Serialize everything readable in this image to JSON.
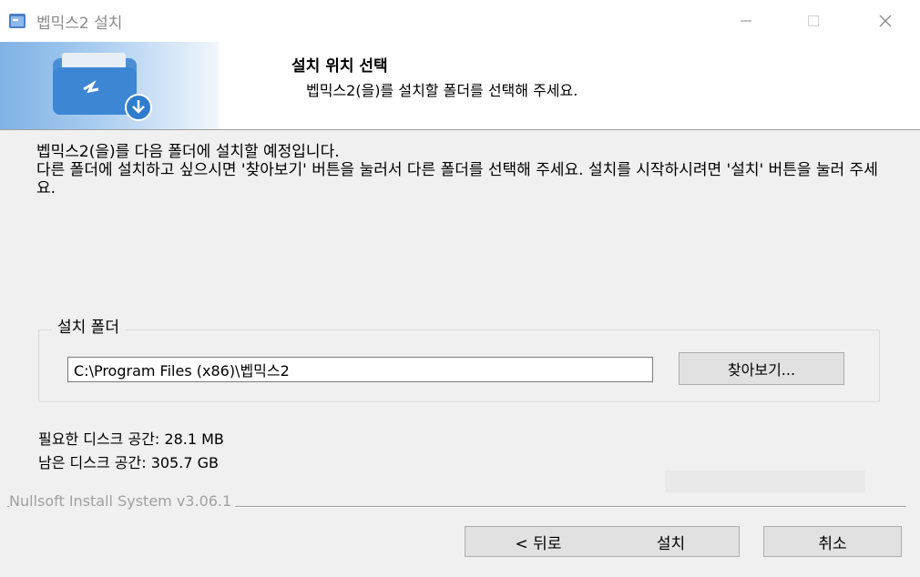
{
  "window": {
    "title": "벱믹스2 설치",
    "minimize_icon": "minimize-icon",
    "maximize_icon": "maximize-icon",
    "close_icon": "close-icon"
  },
  "header": {
    "title": "설치 위치 선택",
    "subtitle": "벱믹스2(을)를 설치할 폴더를 선택해 주세요.",
    "banner_icon": "folder-download-icon"
  },
  "description": {
    "line1": "벱믹스2(을)를 다음 폴더에 설치할 예정입니다.",
    "line2": "다른 폴더에 설치하고 싶으시면 '찾아보기' 버튼을 눌러서 다른 폴더를 선택해 주세요. 설치를 시작하시려면 '설치' 버튼을 눌러 주세요."
  },
  "install_folder": {
    "label": "설치 폴더",
    "path": "C:\\Program Files (x86)\\벱믹스2",
    "browse_label": "찾아보기..."
  },
  "disk": {
    "required": "필요한 디스크 공간: 28.1 MB",
    "available": "남은 디스크 공간: 305.7 GB"
  },
  "footer": {
    "branding": "Nullsoft Install System v3.06.1",
    "back_label": "< 뒤로",
    "install_label": "설치",
    "cancel_label": "취소"
  }
}
